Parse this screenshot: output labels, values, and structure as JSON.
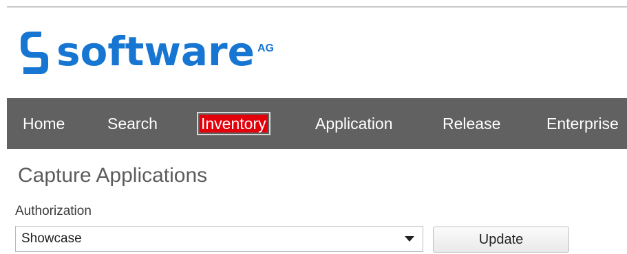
{
  "logo": {
    "word": "software",
    "suffix": "AG",
    "color": "#1776d2",
    "icon": "software-ag-s-mark"
  },
  "nav": {
    "background": "#616161",
    "active_color": "#e3000b",
    "items": [
      {
        "label": "Home",
        "active": false
      },
      {
        "label": "Search",
        "active": false
      },
      {
        "label": "Inventory",
        "active": true
      },
      {
        "label": "Application",
        "active": false
      },
      {
        "label": "Release",
        "active": false
      },
      {
        "label": "Enterprise",
        "active": false
      }
    ]
  },
  "page": {
    "title": "Capture Applications"
  },
  "form": {
    "authorization_label": "Authorization",
    "authorization_value": "Showcase",
    "update_label": "Update"
  }
}
